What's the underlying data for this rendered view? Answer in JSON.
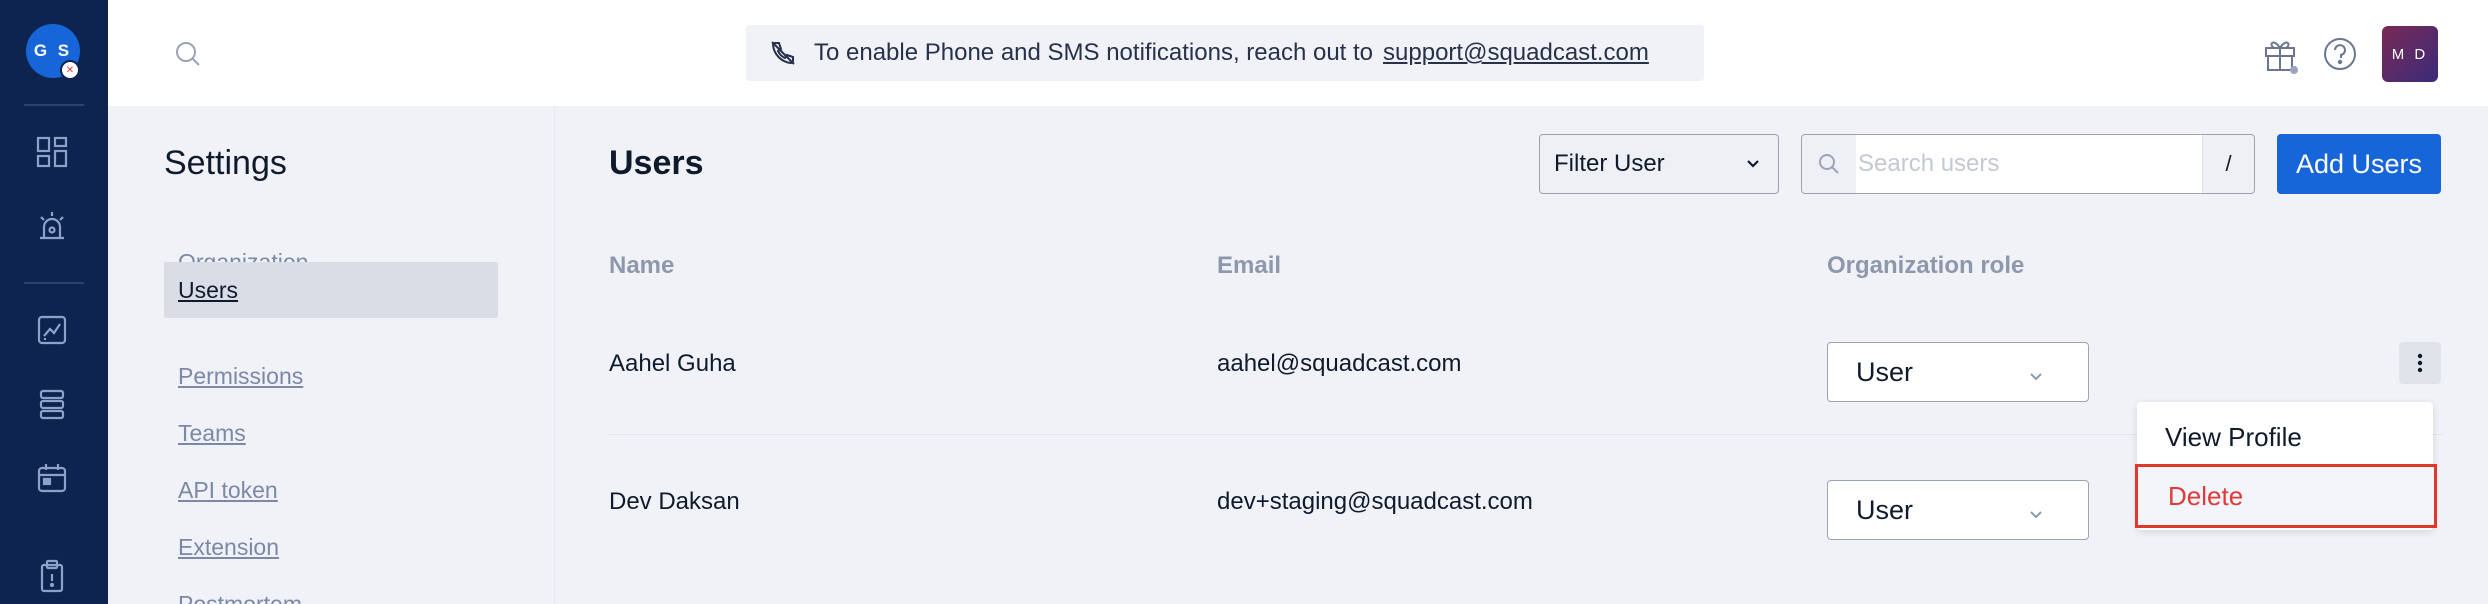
{
  "leftnav": {
    "org_initials": "G S",
    "items": [
      "dashboard-icon",
      "alert-icon",
      "analytics-icon",
      "services-icon",
      "calendar-icon",
      "clipboard-icon"
    ]
  },
  "topbar": {
    "banner_text": "To enable Phone and SMS notifications, reach out to",
    "banner_link": "support@squadcast.com",
    "user_initials": "M D"
  },
  "settings": {
    "title": "Settings",
    "items": [
      {
        "label": "Organization",
        "active": false
      },
      {
        "label": "Users",
        "active": true
      },
      {
        "label": "Permissions",
        "active": false
      },
      {
        "label": "Teams",
        "active": false
      },
      {
        "label": "API token",
        "active": false
      },
      {
        "label": "Extension",
        "active": false
      },
      {
        "label": "Postmortem",
        "active": false
      }
    ]
  },
  "main": {
    "title": "Users",
    "filter_label": "Filter User",
    "search_placeholder": "Search users",
    "search_shortcut": "/",
    "add_button": "Add Users",
    "columns": [
      "Name",
      "Email",
      "Organization role"
    ],
    "rows": [
      {
        "name": "Aahel Guha",
        "email": "aahel@squadcast.com",
        "role": "User"
      },
      {
        "name": "Dev Daksan",
        "email": "dev+staging@squadcast.com",
        "role": "User"
      }
    ]
  },
  "menu": {
    "view_profile": "View Profile",
    "delete": "Delete"
  },
  "colors": {
    "nav_bg": "#0d2451",
    "accent": "#1766d9",
    "danger": "#e03a3a"
  }
}
